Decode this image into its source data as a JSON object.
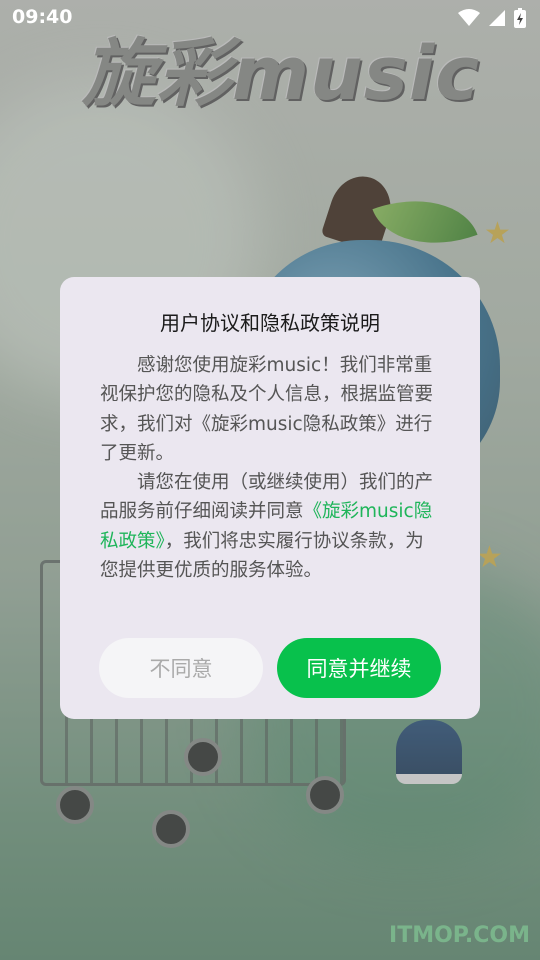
{
  "status_bar": {
    "time": "09:40"
  },
  "splash": {
    "brand": "旋彩music",
    "watermark": "ITMOP.COM"
  },
  "dialog": {
    "title": "用户协议和隐私政策说明",
    "para1": "感谢您使用旋彩music！我们非常重视保护您的隐私及个人信息，根据监管要求，我们对《旋彩music隐私政策》进行了更新。",
    "para2_before": "请您在使用（或继续使用）我们的产品服务前仔细阅读并同意",
    "para2_link": "《旋彩music隐私政策》",
    "para2_after": "，我们将忠实履行协议条款，为您提供更优质的服务体验。",
    "decline_label": "不同意",
    "accept_label": "同意并继续"
  },
  "colors": {
    "accent": "#08c14c",
    "link": "#1fb55a",
    "dialog_bg": "#ebe7f0"
  },
  "icons": [
    "wifi-icon",
    "signal-icon",
    "battery-icon"
  ]
}
